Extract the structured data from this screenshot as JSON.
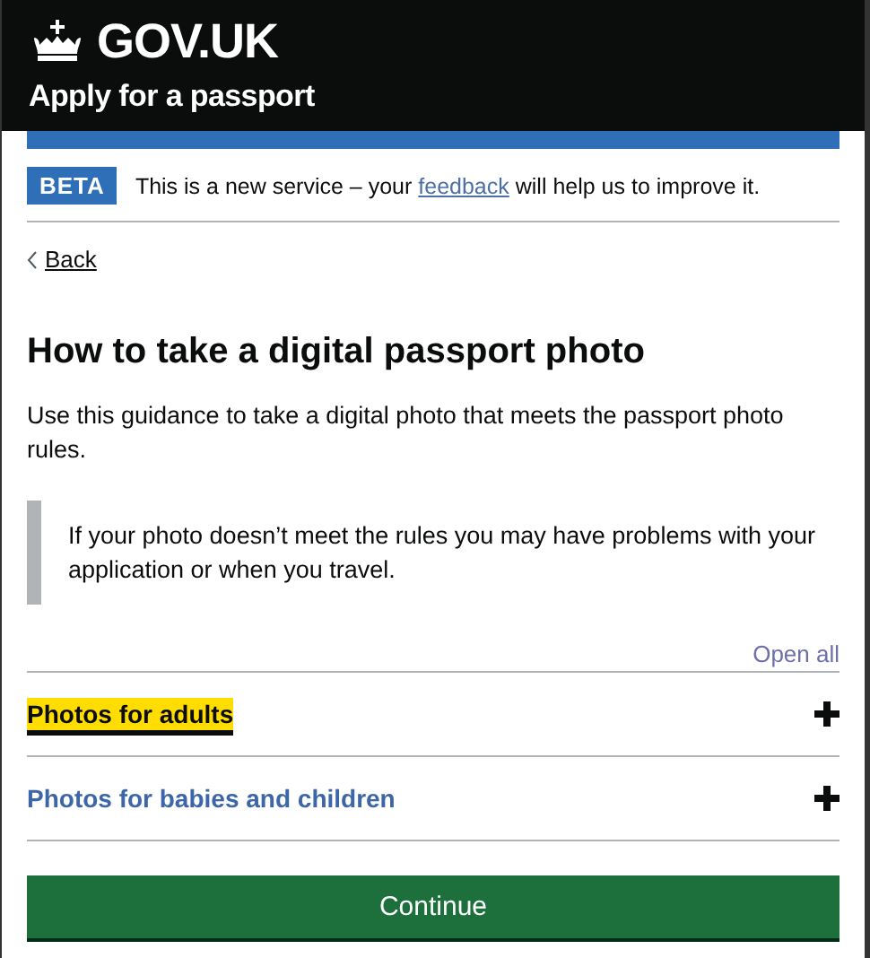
{
  "header": {
    "logo_text": "GOV.UK",
    "service_name": "Apply for a passport"
  },
  "phase_banner": {
    "tag": "BETA",
    "text_before": "This is a new service – your",
    "link": "feedback",
    "text_after": "will help us to improve it."
  },
  "back_link": "Back",
  "heading": "How to take a digital passport photo",
  "intro": "Use this guidance to take a digital photo that meets the passport photo rules.",
  "inset": "If your photo doesn’t meet the rules you may have problems with your application or when you travel.",
  "accordion": {
    "open_all": "Open all",
    "sections": [
      {
        "title": "Photos for adults",
        "focused": true,
        "expanded": false
      },
      {
        "title": "Photos for babies and children",
        "focused": false,
        "expanded": false
      }
    ]
  },
  "button": "Continue"
}
